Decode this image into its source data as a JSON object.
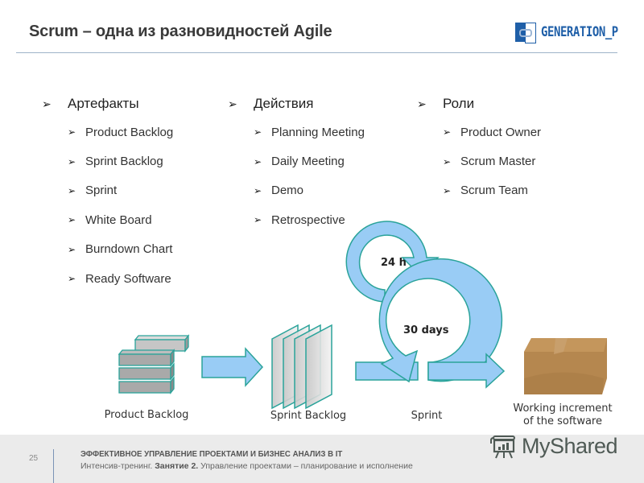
{
  "header": {
    "title": "Scrum – одна из разновидностей Agile",
    "logo_text": "GENERATION_P",
    "brand_color": "#1f5fa8"
  },
  "columns": [
    {
      "heading": "Артефакты",
      "items": [
        "Product Backlog",
        "Sprint Backlog",
        "Sprint",
        "White Board",
        "Burndown Chart",
        "Ready Software"
      ]
    },
    {
      "heading": "Действия",
      "items": [
        "Planning Meeting",
        "Daily Meeting",
        "Demo",
        "Retrospective"
      ]
    },
    {
      "heading": "Роли",
      "items": [
        "Product Owner",
        "Scrum Master",
        "Scrum Team"
      ]
    }
  ],
  "bullet_glyph": "➢",
  "diagram": {
    "stages": [
      {
        "name": "product-backlog",
        "label": "Product Backlog"
      },
      {
        "name": "sprint-backlog",
        "label": "Sprint Backlog"
      },
      {
        "name": "sprint",
        "label": "Sprint"
      },
      {
        "name": "increment",
        "label_line1": "Working increment",
        "label_line2": "of the software"
      }
    ],
    "daily_cycle_label": "24 h",
    "sprint_cycle_label": "30 days",
    "arrow_fill": "#99ccf5",
    "arrow_stroke": "#2aa39a",
    "box_color": "#b5874f"
  },
  "footer": {
    "page_number": "25",
    "line1": "ЭФФЕКТИВНОЕ УПРАВЛЕНИЕ ПРОЕКТАМИ И БИЗНЕС АНАЛИЗ В IT",
    "line2_prefix": "Интенсив-тренинг. ",
    "line2_bold": "Занятие 2.",
    "line2_suffix": " Управление проектами – планирование и исполнение"
  },
  "watermark": {
    "text": "MyShared"
  }
}
